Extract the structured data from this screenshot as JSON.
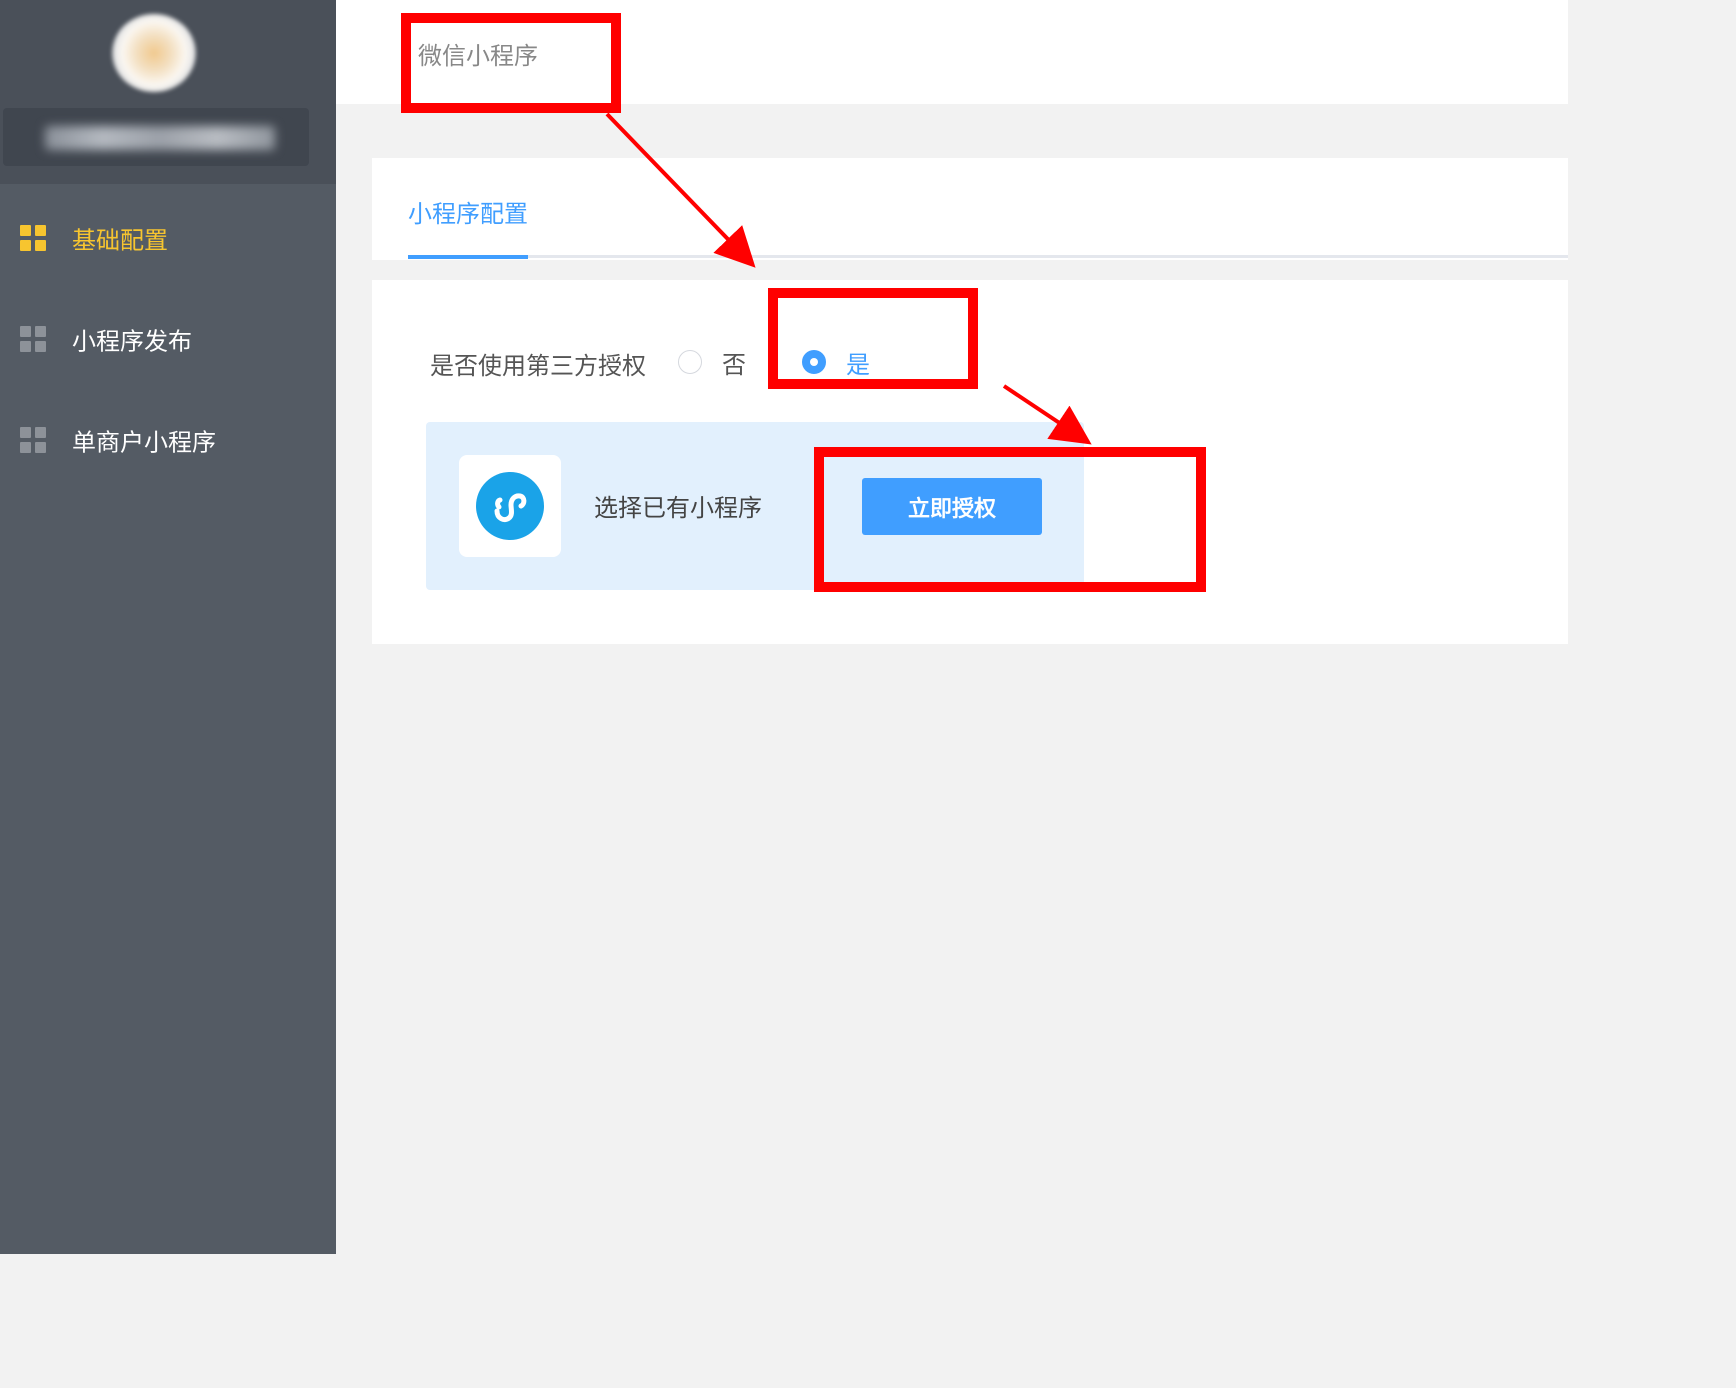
{
  "sidebar": {
    "items": [
      {
        "label": "基础配置",
        "active": true,
        "icon": "grid-icon"
      },
      {
        "label": "小程序发布",
        "active": false,
        "icon": "grid-icon"
      },
      {
        "label": "单商户小程序",
        "active": false,
        "icon": "grid-icon"
      }
    ]
  },
  "header": {
    "title": "微信小程序"
  },
  "tabs": [
    {
      "label": "小程序配置",
      "active": true
    }
  ],
  "form": {
    "third_party_label": "是否使用第三方授权",
    "options": [
      {
        "label": "否",
        "checked": false
      },
      {
        "label": "是",
        "checked": true
      }
    ]
  },
  "auth": {
    "text": "选择已有小程序",
    "button_label": "立即授权",
    "icon": "mini-program-icon"
  },
  "colors": {
    "sidebar_bg": "#545b64",
    "active_nav": "#f7c52f",
    "primary": "#409eff",
    "annotation": "#ff0000"
  }
}
